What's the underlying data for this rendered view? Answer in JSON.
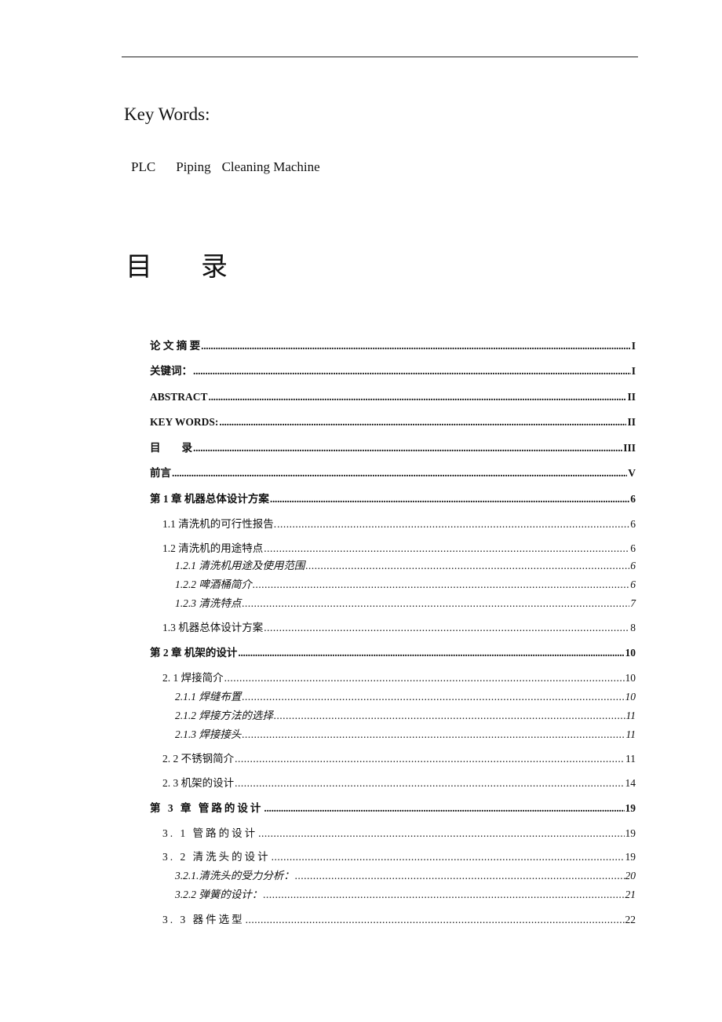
{
  "header": {
    "rule": true
  },
  "keywords": {
    "heading": "Key Words:",
    "items": [
      "PLC",
      "Piping",
      "Cleaning Machine"
    ]
  },
  "toc": {
    "title_chars": [
      "目",
      "录"
    ],
    "entries": [
      {
        "label": "论 文 摘 要",
        "page": "I",
        "level": 0
      },
      {
        "label": "关键词：",
        "page": "I",
        "level": 0
      },
      {
        "label": "ABSTRACT",
        "page": "II",
        "level": 0
      },
      {
        "label": "KEY WORDS:",
        "page": "II",
        "level": 0
      },
      {
        "label": "目　　录",
        "page": "III",
        "level": 0
      },
      {
        "label": "前言",
        "page": "V",
        "level": 0
      },
      {
        "label": "第 1 章  机器总体设计方案",
        "page": "6",
        "level": 0
      },
      {
        "label": "1.1 清洗机的可行性报告.",
        "page": "6",
        "level": 1
      },
      {
        "label": "1.2 清洗机的用途特点",
        "page": "6",
        "level": 1
      },
      {
        "label": "1.2.1 清洗机用途及使用范围",
        "page": "6",
        "level": 2
      },
      {
        "label": "1.2.2 啤酒桶简介",
        "page": "6",
        "level": 2
      },
      {
        "label": "1.2.3 清洗特点",
        "page": "7",
        "level": 2
      },
      {
        "label": "1.3 机器总体设计方案",
        "page": "8",
        "level": 1
      },
      {
        "label": "第 2 章  机架的设计",
        "page": "10",
        "level": 0
      },
      {
        "label": "2. 1 焊接简介",
        "page": "10",
        "level": 1
      },
      {
        "label": "2.1.1 焊缝布置",
        "page": "10",
        "level": 2
      },
      {
        "label": "2.1.2 焊接方法的选择",
        "page": "11",
        "level": 2
      },
      {
        "label": "2.1.3  焊接接头",
        "page": "11",
        "level": 2
      },
      {
        "label": "2. 2 不锈钢简介",
        "page": "11",
        "level": 1
      },
      {
        "label": "2. 3 机架的设计",
        "page": "14",
        "level": 1
      },
      {
        "label": "第 3 章  管路的设计",
        "page": "19",
        "level": 0
      },
      {
        "label": "3. 1 管路的设计",
        "page": "19",
        "level": 1
      },
      {
        "label": "3. 2   清洗头的设计",
        "page": "19",
        "level": 1
      },
      {
        "label": "3.2.1.清洗头的受力分析：",
        "page": "20",
        "level": 2
      },
      {
        "label": "3.2.2 弹簧的设计：",
        "page": "21",
        "level": 2
      },
      {
        "label": "3. 3  器件选型",
        "page": "22",
        "level": 1
      }
    ]
  }
}
